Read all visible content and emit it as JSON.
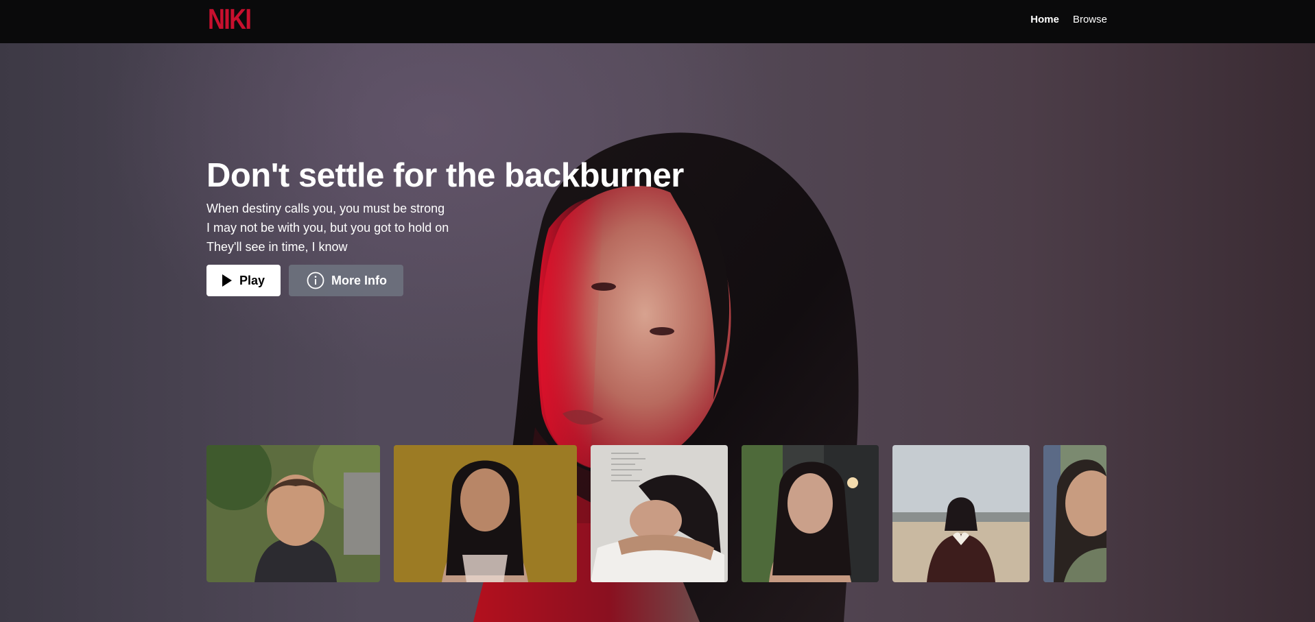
{
  "app": {
    "logo_text": "NIKI",
    "brand_color": "#c8102e"
  },
  "nav": {
    "links": [
      {
        "label": "Home",
        "active": true
      },
      {
        "label": "Browse",
        "active": false
      }
    ]
  },
  "hero": {
    "title": "Don't settle for the backburner",
    "lines": [
      "When destiny calls you, you must be strong",
      "I may not be with you, but you got to hold on",
      "They'll see in time, I know"
    ],
    "background_image": "portrait of a woman with long dark hair lit by red light",
    "buttons": {
      "play": {
        "label": "Play",
        "icon": "play-icon"
      },
      "info": {
        "label": "More Info",
        "icon": "info-icon"
      }
    }
  },
  "thumbnails": [
    {
      "description": "smiling woman outdoors in front of green trees",
      "bg": "#5d6d3f"
    },
    {
      "description": "woman with long dark hair against mustard yellow wall",
      "bg": "#b28c2a"
    },
    {
      "description": "woman resting head on arms, white background with handwritten notes",
      "bg": "#d8d6d2"
    },
    {
      "description": "woman with long dark hair, dark building and lamp behind",
      "bg": "#3a3d3c"
    },
    {
      "description": "woman holding paper heart on a beach, overcast sky",
      "bg": "#c6ccd1"
    },
    {
      "description": "woman close-up, partially visible",
      "bg": "#7b8a70"
    }
  ]
}
